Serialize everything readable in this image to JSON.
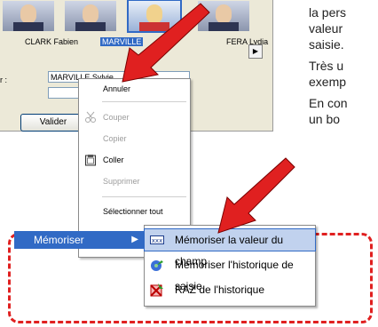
{
  "window": {
    "people": [
      {
        "name": "CLARK Fabien",
        "selected": false
      },
      {
        "name": "MARVILLE",
        "selected": true
      },
      {
        "name": "FERA Lydia",
        "selected": false
      }
    ],
    "field_label": "r :",
    "field_value": "MARVILLE Sylvie",
    "valider_label": "Valider"
  },
  "context_menu": {
    "items": [
      {
        "label": "Annuler",
        "enabled": true
      },
      {
        "label": "Couper",
        "enabled": false,
        "icon": "scissors-icon"
      },
      {
        "label": "Copier",
        "enabled": false
      },
      {
        "label": "Coller",
        "enabled": true,
        "icon": "paste-icon"
      },
      {
        "label": "Supprimer",
        "enabled": false
      },
      {
        "label": "Sélectionner tout",
        "enabled": true
      }
    ]
  },
  "side_text": {
    "line1": "la pers",
    "line2": "valeur",
    "line3": "saisie.",
    "line4": "Très u",
    "line5": "exemp",
    "line6": "En con",
    "line7": "un bo"
  },
  "bottom_menu": {
    "parent_label": "Mémoriser",
    "submenu": [
      {
        "label": "Mémoriser la valeur du champ",
        "icon": "memorize-value-icon",
        "highlighted": true
      },
      {
        "label": "Mémoriser l'historique de saisie",
        "icon": "history-icon",
        "highlighted": false
      },
      {
        "label": "RAZ de l'historique",
        "icon": "reset-history-icon",
        "highlighted": false
      }
    ]
  },
  "colors": {
    "highlight": "#316ac5",
    "annotation_red": "#e02020"
  }
}
